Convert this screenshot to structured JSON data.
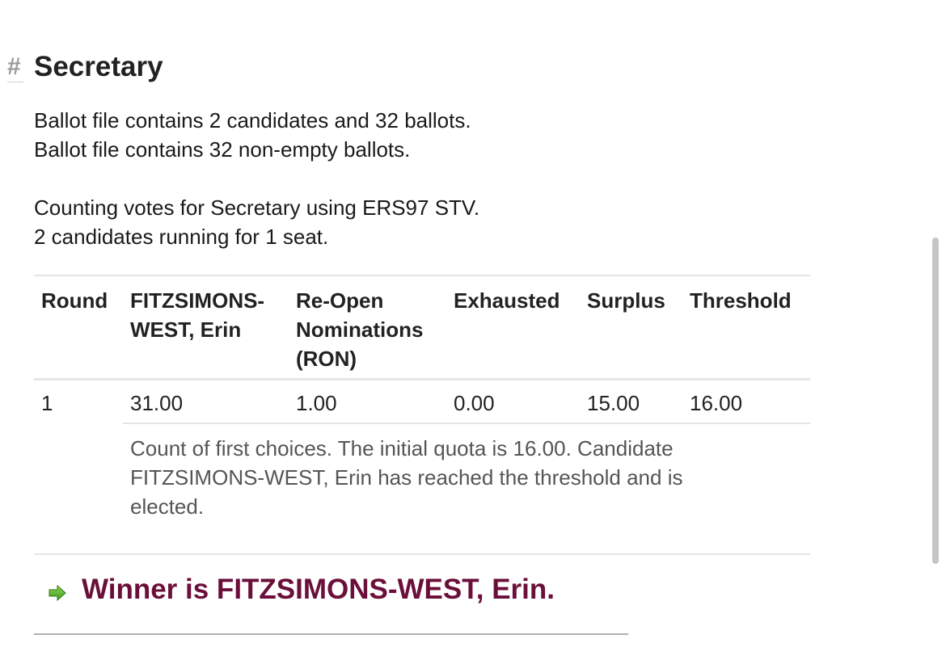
{
  "section": {
    "anchor": "#",
    "title": "Secretary"
  },
  "info": {
    "line1": "Ballot file contains 2 candidates and 32 ballots.",
    "line2": "Ballot file contains 32 non-empty ballots.",
    "line3": "Counting votes for Secretary using ERS97 STV.",
    "line4": "2 candidates running for 1 seat."
  },
  "table": {
    "headers": {
      "round": "Round",
      "candidate1_line1": "FITZSIMONS-",
      "candidate1_line2": "WEST, Erin",
      "candidate2_line1": "Re-Open",
      "candidate2_line2": "Nominations",
      "candidate2_line3": "(RON)",
      "exhausted": "Exhausted",
      "surplus": "Surplus",
      "threshold": "Threshold"
    },
    "rows": [
      {
        "round": "1",
        "candidate1": "31.00",
        "candidate2": "1.00",
        "exhausted": "0.00",
        "surplus": "15.00",
        "threshold": "16.00",
        "note": "Count of first choices. The initial quota is 16.00. Candidate FITZSIMONS-WEST, Erin has reached the threshold and is elected."
      }
    ]
  },
  "winner": {
    "icon": "green-arrow-icon",
    "text": "Winner is FITZSIMONS-WEST, Erin."
  },
  "colors": {
    "winner": "#6b0f3a",
    "arrow": "#5cb82e"
  }
}
